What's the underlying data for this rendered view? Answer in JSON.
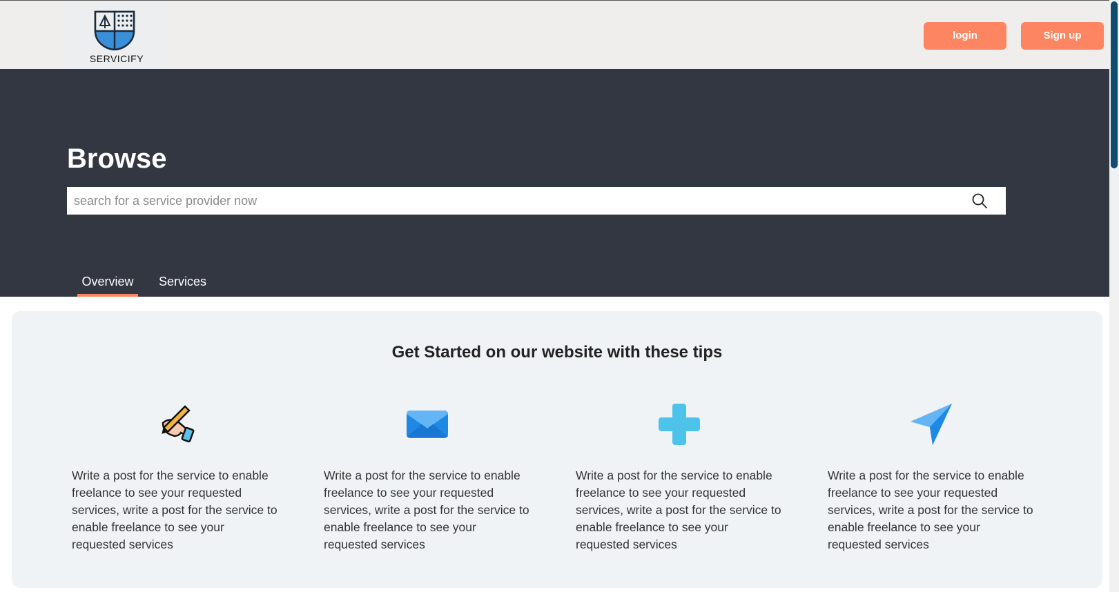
{
  "header": {
    "logo_text": "SERVICIFY",
    "login_label": "login",
    "signup_label": "Sign up"
  },
  "hero": {
    "title": "Browse",
    "search_placeholder": "search for a service provider now"
  },
  "tabs": [
    {
      "label": "Overview",
      "active": true
    },
    {
      "label": "Services",
      "active": false
    }
  ],
  "tips": {
    "heading": "Get Started on our website with these tips",
    "items": [
      {
        "icon": "hand-writing-pen-icon",
        "text": "Write a post for the service to enable freelance to see your requested services, write a post for the service to enable freelance to see your requested services"
      },
      {
        "icon": "envelope-icon",
        "text": "Write a post for the service to enable freelance to see your requested services, write a post for the service to enable freelance to see your requested services"
      },
      {
        "icon": "plus-icon",
        "text": "Write a post for the service to enable freelance to see your requested services, write a post for the service to enable freelance to see your requested services"
      },
      {
        "icon": "paper-plane-icon",
        "text": "Write a post for the service to enable freelance to see your requested services, write a post for the service to enable freelance to see your requested services"
      }
    ]
  },
  "colors": {
    "accent": "#fd8561",
    "hero_bg": "#333742",
    "panel_bg": "#f0f3f6",
    "header_bg": "#efeeec"
  }
}
